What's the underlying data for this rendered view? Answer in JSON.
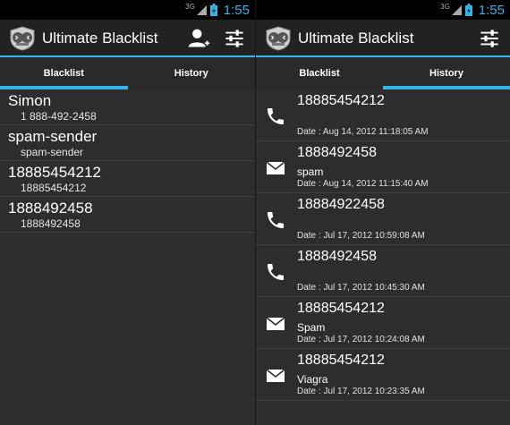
{
  "status": {
    "network": "3G",
    "time": "1:55"
  },
  "app": {
    "title": "Ultimate Blacklist"
  },
  "tabs": [
    "Blacklist",
    "History"
  ],
  "blacklist": [
    {
      "name": "Simon",
      "number": "1 888-492-2458"
    },
    {
      "name": "spam-sender",
      "number": "spam-sender"
    },
    {
      "name": "18885454212",
      "number": "18885454212"
    },
    {
      "name": "1888492458",
      "number": "1888492458"
    }
  ],
  "history": [
    {
      "type": "call",
      "icon": "phone-icon",
      "number": "18885454212",
      "message": "",
      "date": "Date : Aug 14, 2012 11:18:05 AM"
    },
    {
      "type": "sms",
      "icon": "envelope-icon",
      "number": "1888492458",
      "message": "spam",
      "date": "Date : Aug 14, 2012 11:15:40 AM"
    },
    {
      "type": "call",
      "icon": "phone-icon",
      "number": "18884922458",
      "message": "",
      "date": "Date : Jul 17, 2012 10:59:08 AM"
    },
    {
      "type": "call",
      "icon": "phone-icon",
      "number": "1888492458",
      "message": "",
      "date": "Date : Jul 17, 2012 10:45:30 AM"
    },
    {
      "type": "sms",
      "icon": "envelope-icon",
      "number": "18885454212",
      "message": "Spam",
      "date": "Date : Jul 17, 2012 10:24:08 AM"
    },
    {
      "type": "sms",
      "icon": "envelope-icon",
      "number": "18885454212",
      "message": "Viagra",
      "date": "Date : Jul 17, 2012 10:23:35 AM"
    }
  ],
  "colors": {
    "accent": "#33b5e5",
    "background": "#2d2d2d",
    "actionbar": "#222222"
  }
}
